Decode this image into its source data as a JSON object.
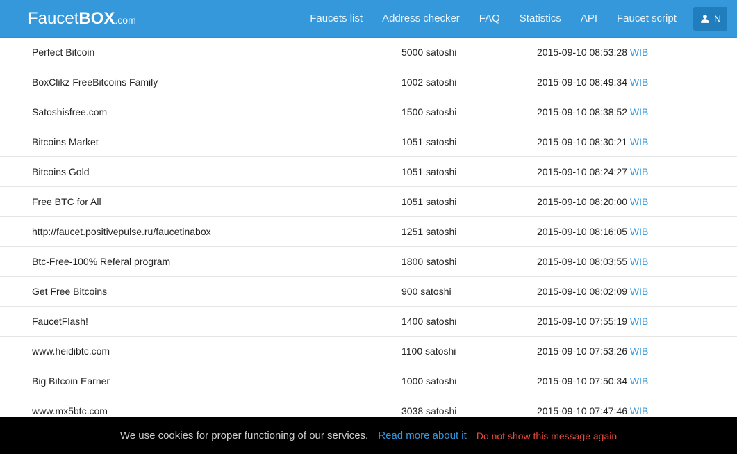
{
  "brand": {
    "part1": "Faucet",
    "part2": "BOX",
    "domain": ".com"
  },
  "nav": {
    "faucets_list": "Faucets list",
    "address_checker": "Address checker",
    "faq": "FAQ",
    "statistics": "Statistics",
    "api": "API",
    "faucet_script": "Faucet script",
    "user_initial": "N"
  },
  "tz": "WIB",
  "rows": [
    {
      "name": "Perfect Bitcoin",
      "amount": "5000 satoshi",
      "date": "2015-09-10 08:53:28"
    },
    {
      "name": "BoxClikz FreeBitcoins Family",
      "amount": "1002 satoshi",
      "date": "2015-09-10 08:49:34"
    },
    {
      "name": "Satoshisfree.com",
      "amount": "1500 satoshi",
      "date": "2015-09-10 08:38:52"
    },
    {
      "name": "Bitcoins Market",
      "amount": "1051 satoshi",
      "date": "2015-09-10 08:30:21"
    },
    {
      "name": "Bitcoins Gold",
      "amount": "1051 satoshi",
      "date": "2015-09-10 08:24:27"
    },
    {
      "name": "Free BTC for All",
      "amount": "1051 satoshi",
      "date": "2015-09-10 08:20:00"
    },
    {
      "name": "http://faucet.positivepulse.ru/faucetinabox",
      "amount": "1251 satoshi",
      "date": "2015-09-10 08:16:05"
    },
    {
      "name": "Btc-Free-100% Referal program",
      "amount": "1800 satoshi",
      "date": "2015-09-10 08:03:55"
    },
    {
      "name": "Get Free Bitcoins",
      "amount": "900 satoshi",
      "date": "2015-09-10 08:02:09"
    },
    {
      "name": "FaucetFlash!",
      "amount": "1400 satoshi",
      "date": "2015-09-10 07:55:19"
    },
    {
      "name": "www.heidibtc.com",
      "amount": "1100 satoshi",
      "date": "2015-09-10 07:53:26"
    },
    {
      "name": "Big Bitcoin Earner",
      "amount": "1000 satoshi",
      "date": "2015-09-10 07:50:34"
    },
    {
      "name": "www.mx5btc.com",
      "amount": "3038 satoshi",
      "date": "2015-09-10 07:47:46"
    }
  ],
  "cookie": {
    "text": "We use cookies for proper functioning of our services.",
    "read_more": "Read more about it",
    "dismiss": "Do not show this message again"
  }
}
